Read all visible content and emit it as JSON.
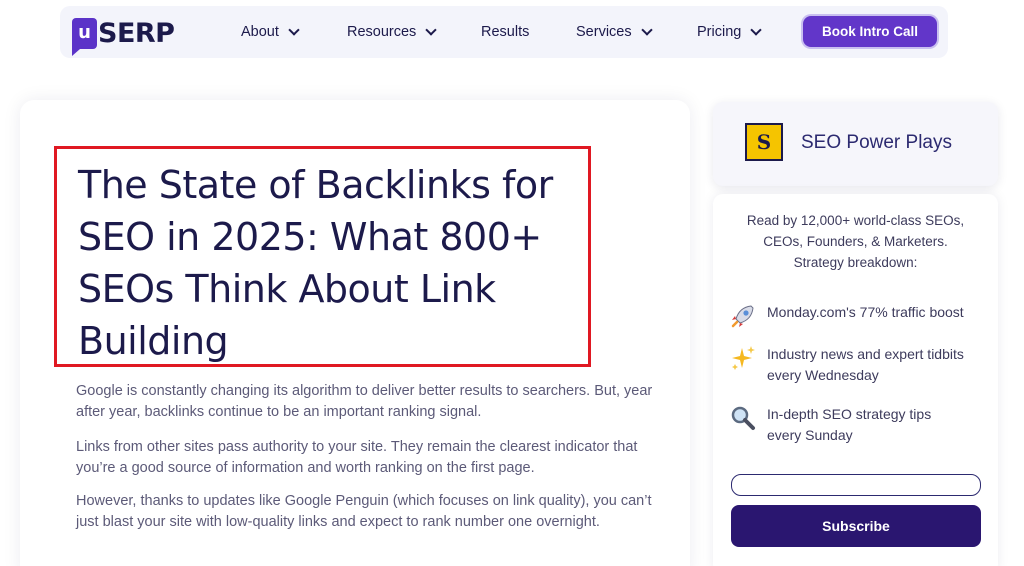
{
  "brand": {
    "logo_letter": "u",
    "logo_text": "SERP",
    "accent": "#6236c9"
  },
  "nav": {
    "items": [
      {
        "label": "About",
        "has_dropdown": true
      },
      {
        "label": "Resources",
        "has_dropdown": true
      },
      {
        "label": "Results",
        "has_dropdown": false
      },
      {
        "label": "Services",
        "has_dropdown": true
      },
      {
        "label": "Pricing",
        "has_dropdown": true
      }
    ],
    "cta_label": "Book Intro Call"
  },
  "article": {
    "title": "The State of Backlinks for SEO in 2025: What 800+ SEOs Think About Link Building",
    "highlight_color": "#e01822",
    "paragraphs": [
      "Google is constantly changing its algorithm to deliver better results to searchers. But, year after year, backlinks continue to be an important ranking signal.",
      "Links from other sites pass authority to your site. They remain the clearest indicator that you’re a good source of information and worth ranking on the first page.",
      "However, thanks to updates like Google Penguin (which focuses on link quality), you can’t just blast your site with low-quality links and expect to rank number one overnight."
    ]
  },
  "sidebar": {
    "logo_letter": "S",
    "title": "SEO Power Plays",
    "intro_lines": [
      "Read by 12,000+ world-class SEOs,",
      "CEOs, Founders, & Marketers.",
      "Strategy breakdown:"
    ],
    "items": [
      {
        "icon": "rocket-icon",
        "text": "Monday.com's 77% traffic boost"
      },
      {
        "icon": "sparkles-icon",
        "text": "Industry news and expert tidbits every Wednesday"
      },
      {
        "icon": "magnifier-icon",
        "text": "In-depth SEO strategy tips every Sunday"
      }
    ],
    "email_placeholder": "",
    "subscribe_label": "Subscribe"
  }
}
